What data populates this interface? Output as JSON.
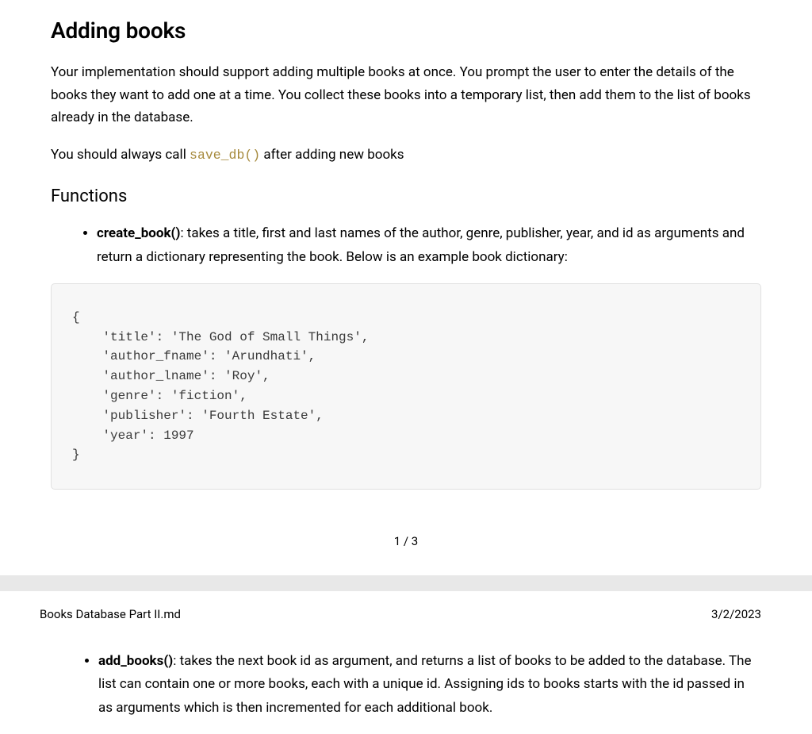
{
  "page1": {
    "heading": "Adding books",
    "intro_paragraph": "Your implementation should support adding multiple books at once. You prompt the user to enter the details of the books they want to add one at a time. You collect these books into a temporary list, then add them to the list of books already in the database.",
    "save_db_sentence_prefix": "You should always call ",
    "save_db_code": "save_db()",
    "save_db_sentence_suffix": " after adding new books",
    "functions_heading": "Functions",
    "create_book": {
      "name": "create_book()",
      "description": ": takes a title, first and last names of the author, genre, publisher, year, and id as arguments and return a dictionary representing the book. Below is an example book dictionary:"
    },
    "code_block": "{\n    'title': 'The God of Small Things',\n    'author_fname': 'Arundhati',\n    'author_lname': 'Roy',\n    'genre': 'fiction',\n    'publisher': 'Fourth Estate',\n    'year': 1997\n}",
    "page_number": "1 / 3"
  },
  "page2": {
    "doc_title": "Books Database Part II.md",
    "doc_date": "3/2/2023",
    "add_books": {
      "name": "add_books()",
      "description": ": takes the next book id as argument, and returns a list of books to be added to the database. The list can contain one or more books, each with a unique id. Assigning ids to books starts with the id passed in as arguments which is then incremented for each additional book."
    }
  }
}
